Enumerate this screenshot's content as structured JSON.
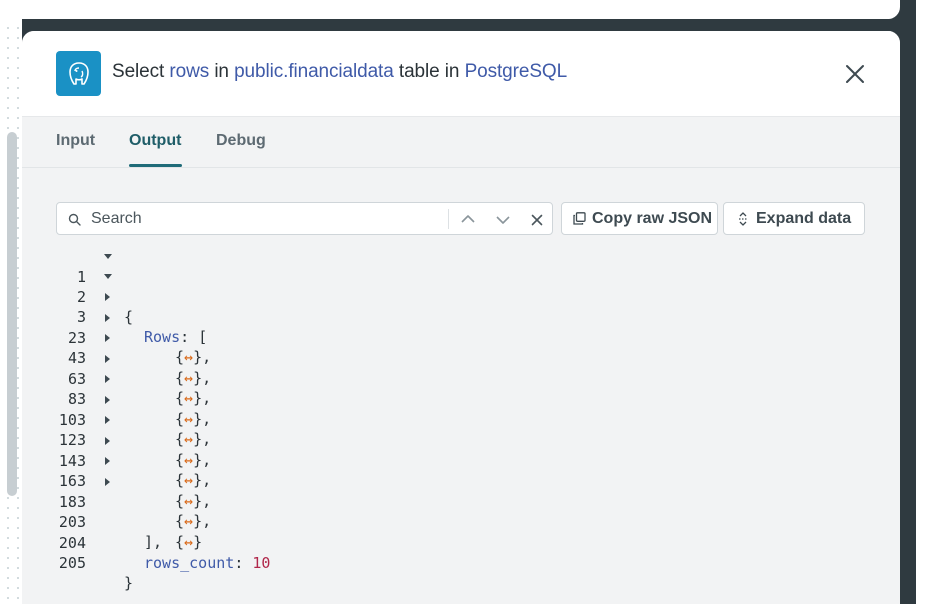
{
  "header": {
    "title_prefix": "Select",
    "title_rows": "rows",
    "title_in1": "in",
    "title_table": "public.financialdata",
    "title_table_in": "table in",
    "title_db": "PostgreSQL",
    "logo_icon": "postgresql-elephant-icon",
    "logo_color": "#1a91c5"
  },
  "tabs": [
    {
      "label": "Input",
      "active": false
    },
    {
      "label": "Output",
      "active": true
    },
    {
      "label": "Debug",
      "active": false
    }
  ],
  "search": {
    "placeholder": "Search",
    "value": ""
  },
  "toolbar": {
    "copy_label": "Copy raw JSON",
    "expand_label": "Expand data"
  },
  "code": {
    "open_brace": "{",
    "rows_key": "Rows",
    "rows_open": "[",
    "collapsed_item": "{↔},",
    "collapsed_last": "{↔}",
    "rows_close": "],",
    "count_key": "rows_count",
    "count_value": "10",
    "close_brace": "}",
    "line_numbers": [
      "1",
      "2",
      "3",
      "23",
      "43",
      "63",
      "83",
      "103",
      "123",
      "143",
      "163",
      "183",
      "203",
      "204",
      "205"
    ]
  },
  "colors": {
    "accent": "#1f6b78",
    "key": "#3f5aa8",
    "number": "#b0264a",
    "collapsed_glyph": "#d96a1a"
  }
}
